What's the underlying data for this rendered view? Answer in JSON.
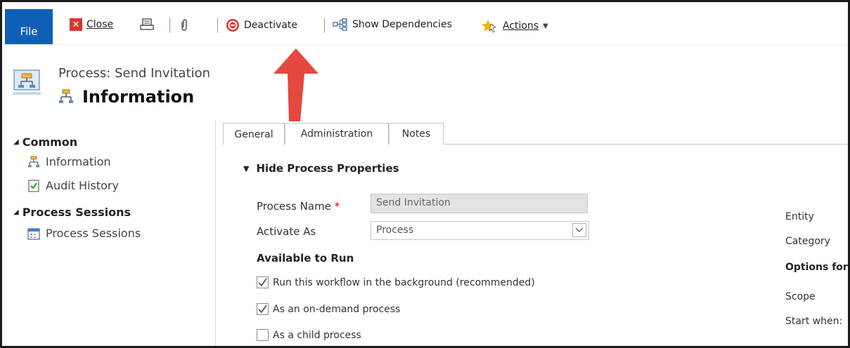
{
  "toolbar": {
    "file": "File",
    "close": "Close",
    "deactivate": "Deactivate",
    "show_dependencies": "Show Dependencies",
    "actions": "Actions"
  },
  "header": {
    "subtitle": "Process: Send Invitation",
    "title": "Information"
  },
  "nav": {
    "common": "Common",
    "information": "Information",
    "audit_history": "Audit History",
    "process_sessions_section": "Process Sessions",
    "process_sessions": "Process Sessions"
  },
  "tabs": [
    {
      "label": "General",
      "active": true
    },
    {
      "label": "Administration",
      "active": false
    },
    {
      "label": "Notes",
      "active": false
    }
  ],
  "section": {
    "title": "Hide Process Properties"
  },
  "form": {
    "process_name_label": "Process Name",
    "required_mark": "*",
    "process_name_value": "Send Invitation",
    "activate_as_label": "Activate As",
    "activate_as_value": "Process",
    "available_to_run": "Available to Run",
    "chk_background": "Run this workflow in the background (recommended)",
    "chk_background_checked": true,
    "chk_on_demand": "As an on-demand process",
    "chk_on_demand_checked": true,
    "chk_child": "As a child process",
    "chk_child_checked": false
  },
  "right_labels": {
    "entity": "Entity",
    "category": "Category",
    "options_for": "Options for",
    "scope": "Scope",
    "start_when": "Start when:"
  },
  "colors": {
    "file_blue": "#1160b7",
    "arrow_red": "#e5483e",
    "required_red": "#dd0000"
  }
}
